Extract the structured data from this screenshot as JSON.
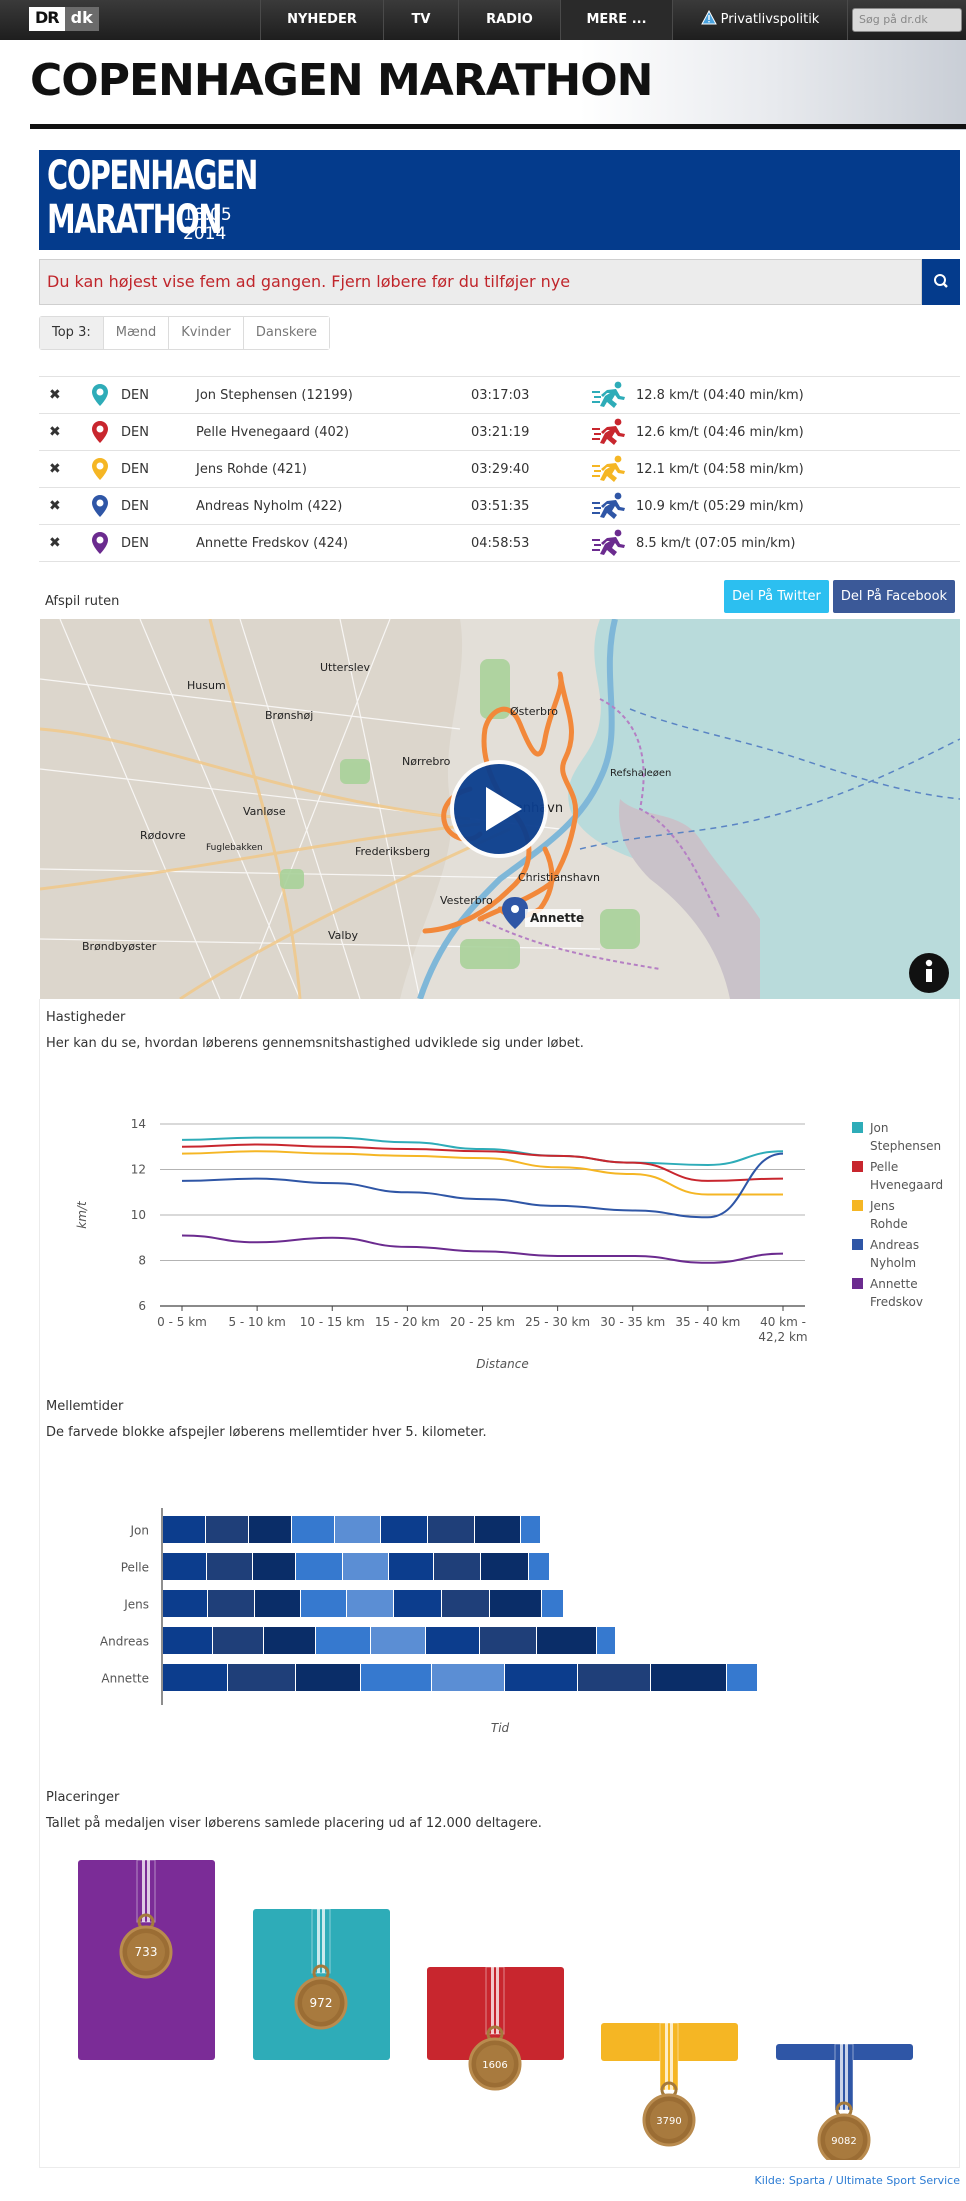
{
  "nav": {
    "logo_dr": "DR",
    "logo_dk": "dk",
    "items": [
      "NYHEDER",
      "TV",
      "RADIO",
      "MERE ..."
    ],
    "privacy": "Privatlivspolitik",
    "search_placeholder": "Søg på dr.dk"
  },
  "page_title": "COPENHAGEN MARATHON",
  "banner": {
    "line1": "COPENHAGEN",
    "line2": "MARATHON",
    "date1": "18.05",
    "date2": "2014"
  },
  "warning": "Du kan højest vise fem ad gangen. Fjern løbere før du tilføjer nye",
  "tabs": [
    "Top 3:",
    "Mænd",
    "Kvinder",
    "Danskere"
  ],
  "runners": [
    {
      "nation": "DEN",
      "name": "Jon Stephensen (12199)",
      "time": "03:17:03",
      "speed": "12.8 km/t (04:40 min/km)",
      "color": "#2eacb8"
    },
    {
      "nation": "DEN",
      "name": "Pelle Hvenegaard (402)",
      "time": "03:21:19",
      "speed": "12.6 km/t (04:46 min/km)",
      "color": "#c8262e"
    },
    {
      "nation": "DEN",
      "name": "Jens Rohde (421)",
      "time": "03:29:40",
      "speed": "12.1 km/t (04:58 min/km)",
      "color": "#f5b624"
    },
    {
      "nation": "DEN",
      "name": "Andreas Nyholm (422)",
      "time": "03:51:35",
      "speed": "10.9 km/t (05:29 min/km)",
      "color": "#2f56a6"
    },
    {
      "nation": "DEN",
      "name": "Annette Fredskov (424)",
      "time": "04:58:53",
      "speed": "8.5 km/t (07:05 min/km)",
      "color": "#6b2b8f"
    }
  ],
  "route": {
    "label": "Afspil ruten",
    "twitter": "Del På Twitter",
    "facebook": "Del På Facebook"
  },
  "map": {
    "places": [
      "Husum",
      "Utterslev",
      "Brønshøj",
      "Østerbro",
      "Nørrebro",
      "Refshaleøen",
      "Vanløse",
      "København",
      "Rødovre",
      "Frederiksberg",
      "Christianshavn",
      "Vesterbro",
      "Valby",
      "Brøndbyøster",
      "Fuglebakken"
    ],
    "marker": "Annette"
  },
  "speeds": {
    "title": "Hastigheder",
    "subtitle": "Her kan du se, hvordan løberens gennemsnitshastighed udviklede sig under løbet."
  },
  "splits": {
    "title": "Mellemtider",
    "subtitle": "De farvede blokke afspejler løberens mellemtider hver 5. kilometer.",
    "xlabel": "Tid",
    "colors": [
      "#0c3d8d",
      "#1f3f79",
      "#0a2d68",
      "#3679cf",
      "#5b8ed4",
      "#0c3d8d",
      "#1f3f79",
      "#0a2d68",
      "#3679cf"
    ],
    "runners": [
      {
        "name": "Jon",
        "blocks": [
          43,
          43,
          43,
          43,
          46,
          47,
          47,
          46,
          20
        ]
      },
      {
        "name": "Pelle",
        "blocks": [
          44,
          46,
          43,
          47,
          46,
          45,
          47,
          48,
          21
        ]
      },
      {
        "name": "Jens",
        "blocks": [
          45,
          47,
          46,
          46,
          47,
          48,
          48,
          52,
          22
        ]
      },
      {
        "name": "Andreas",
        "blocks": [
          50,
          51,
          52,
          55,
          55,
          54,
          57,
          60,
          19
        ]
      },
      {
        "name": "Annette",
        "blocks": [
          65,
          68,
          65,
          71,
          73,
          73,
          73,
          76,
          31
        ]
      }
    ]
  },
  "placements": {
    "title": "Placeringer",
    "subtitle": "Tallet på medaljen viser løberens samlede placering ud af 12.000 deltagere.",
    "medals": [
      {
        "rank": "733",
        "color": "#7b2c97"
      },
      {
        "rank": "972",
        "color": "#2eacb8"
      },
      {
        "rank": "1606",
        "color": "#c8262e"
      },
      {
        "rank": "3790",
        "color": "#f5b624"
      },
      {
        "rank": "9082",
        "color": "#2f56a6"
      }
    ]
  },
  "chart_data": {
    "type": "line",
    "title": "",
    "xlabel": "Distance",
    "ylabel": "km/t",
    "ylim": [
      6,
      14
    ],
    "yticks": [
      6,
      8,
      10,
      12,
      14
    ],
    "categories": [
      "0 - 5 km",
      "5 - 10 km",
      "10 - 15 km",
      "15 - 20 km",
      "20 - 25 km",
      "25 - 30 km",
      "30 - 35 km",
      "35 - 40 km",
      "40 km - 42,2 km"
    ],
    "grid": true,
    "legend": "right",
    "series": [
      {
        "name": "Jon Stephensen",
        "color": "#2eacb8",
        "values": [
          13.3,
          13.4,
          13.4,
          13.2,
          12.9,
          12.6,
          12.3,
          12.2,
          12.8
        ]
      },
      {
        "name": "Pelle Hvenegaard",
        "color": "#c8262e",
        "values": [
          13.0,
          13.1,
          13.0,
          12.9,
          12.8,
          12.6,
          12.3,
          11.5,
          11.6
        ]
      },
      {
        "name": "Jens Rohde",
        "color": "#f5b624",
        "values": [
          12.7,
          12.8,
          12.7,
          12.6,
          12.5,
          12.1,
          11.8,
          10.9,
          10.9
        ]
      },
      {
        "name": "Andreas Nyholm",
        "color": "#2f56a6",
        "values": [
          11.5,
          11.6,
          11.4,
          11.0,
          10.7,
          10.4,
          10.2,
          9.9,
          12.7
        ]
      },
      {
        "name": "Annette Fredskov",
        "color": "#6b2b8f",
        "values": [
          9.1,
          8.8,
          9.0,
          8.6,
          8.4,
          8.2,
          8.2,
          7.9,
          8.3
        ]
      }
    ]
  },
  "source": "Kilde: Sparta / Ultimate Sport Service"
}
